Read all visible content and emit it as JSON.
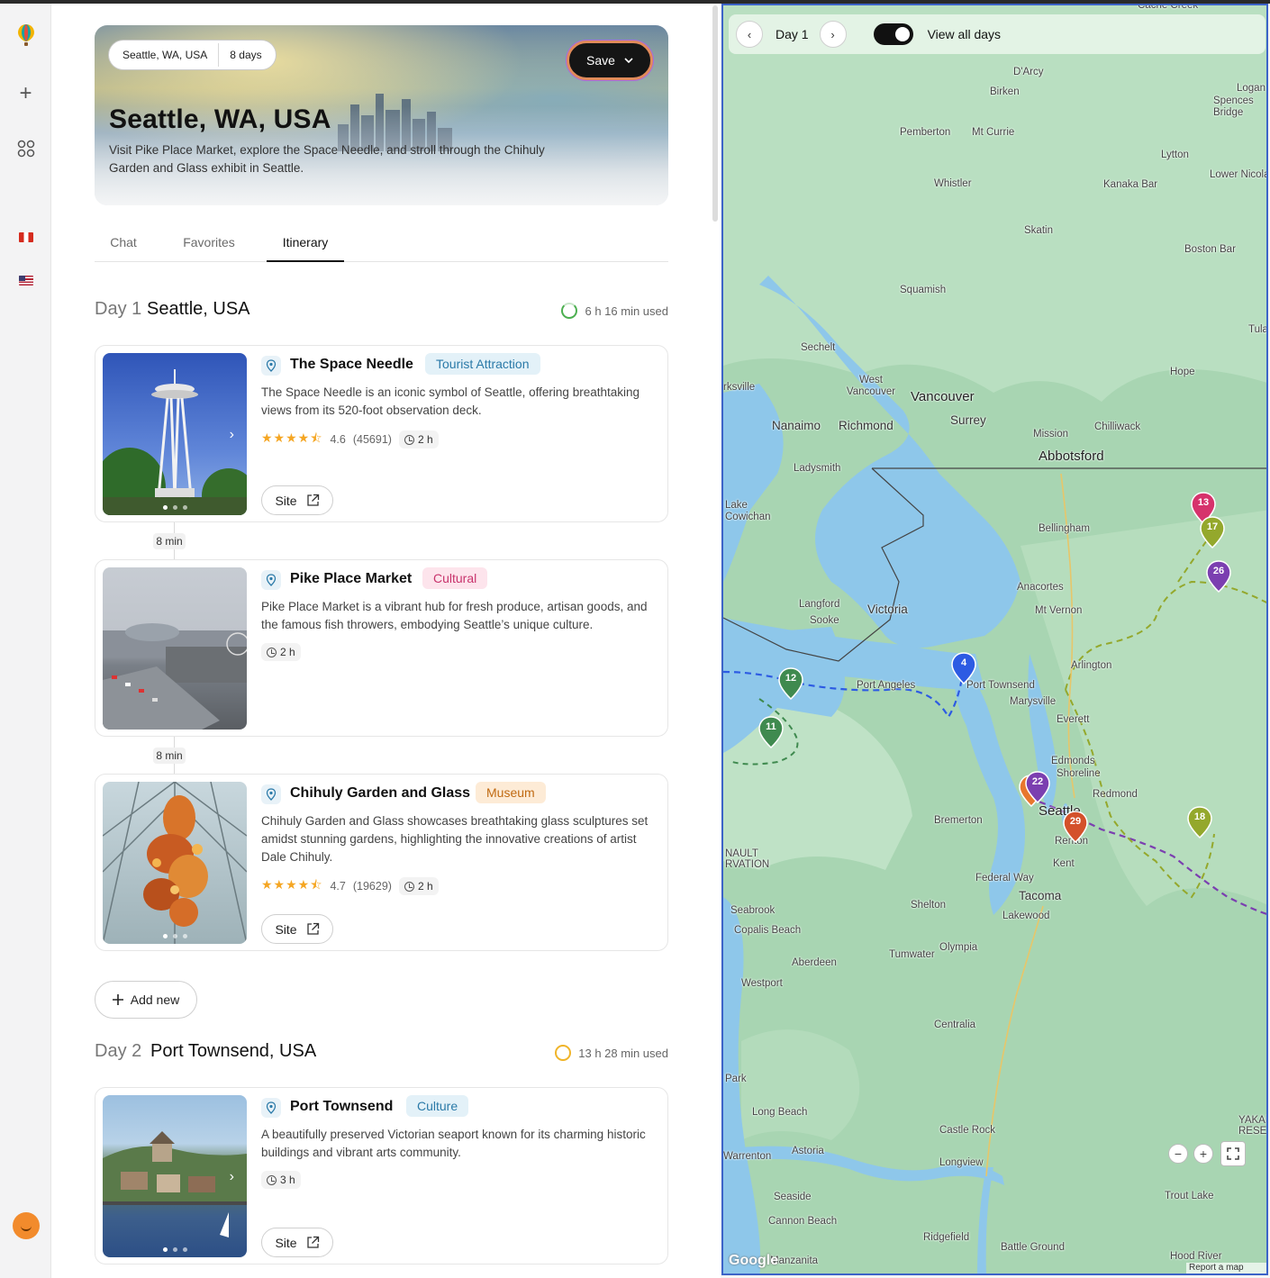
{
  "rail": {
    "items": [
      {
        "name": "balloon-logo-icon"
      },
      {
        "name": "plus-icon",
        "glyph": "+"
      },
      {
        "name": "apps-grid-icon"
      },
      {
        "name": "peru-flag-icon"
      },
      {
        "name": "usa-flag-icon"
      },
      {
        "name": "user-avatar"
      }
    ]
  },
  "hero": {
    "location_chip": "Seattle, WA, USA",
    "duration_chip": "8 days",
    "save_label": "Save",
    "title": "Seattle, WA, USA",
    "description": "Visit Pike Place Market, explore the Space Needle, and stroll through the Chihuly Garden and Glass exhibit in Seattle."
  },
  "tabs": [
    {
      "label": "Chat",
      "active": false
    },
    {
      "label": "Favorites",
      "active": false
    },
    {
      "label": "Itinerary",
      "active": true
    }
  ],
  "days": [
    {
      "label": "Day 1",
      "city": "Seattle, USA",
      "used": "6 h 16 min used",
      "ring_color": "#4caf50",
      "places": [
        {
          "title": "The Space Needle",
          "tag": "Tourist Attraction",
          "tag_color": "#2b7aa8",
          "tag_bg": "#e3f1f8",
          "description": "The Space Needle is an iconic symbol of Seattle, offering breathtaking views from its 520-foot observation deck.",
          "stars": "★★★★⯪",
          "rating": "4.6",
          "reviews": "(45691)",
          "duration": "2 h",
          "site_label": "Site"
        },
        {
          "title": "Pike Place Market",
          "tag": "Cultural",
          "tag_color": "#c8336c",
          "tag_bg": "#fde4ec",
          "description": "Pike Place Market is a vibrant hub for fresh produce, artisan goods, and the famous fish throwers, embodying Seattle’s unique culture.",
          "duration": "2 h"
        },
        {
          "title": "Chihuly Garden and Glass",
          "tag": "Museum",
          "tag_color": "#c06a12",
          "tag_bg": "#fdebd6",
          "description": "Chihuly Garden and Glass showcases breathtaking glass sculptures set amidst stunning gardens, highlighting the innovative creations of artist Dale Chihuly.",
          "stars": "★★★★⯪",
          "rating": "4.7",
          "reviews": "(19629)",
          "duration": "2 h",
          "site_label": "Site"
        }
      ],
      "travel_times": [
        "8 min",
        "8 min"
      ],
      "add_label": "Add new"
    },
    {
      "label": "Day 2",
      "city": "Port Townsend, USA",
      "used": "13 h 28 min used",
      "ring_color": "#f0b429",
      "places": [
        {
          "title": "Port Townsend",
          "tag": "Culture",
          "tag_color": "#2b7aa8",
          "tag_bg": "#e3f1f8",
          "description": "A beautifully preserved Victorian seaport known for its charming historic buildings and vibrant arts community.",
          "duration": "3 h",
          "site_label": "Site"
        }
      ]
    }
  ],
  "map": {
    "day_label": "Day 1",
    "prev_glyph": "‹",
    "next_glyph": "›",
    "toggle_label": "View all days",
    "toggle_on": true,
    "places": [
      "Cache Creek",
      "D'Arcy",
      "Birken",
      "Logan La",
      "Spences Bridge",
      "Pemberton",
      "Mt Currie",
      "Lytton",
      "Lower Nicola",
      "Whistler",
      "Kanaka Bar",
      "Skatin",
      "Boston Bar",
      "Squamish",
      "Tulan",
      "Sechelt",
      "Hope",
      "West Vancouver",
      "Vancouver",
      "rksville",
      "Nanaimo",
      "Richmond",
      "Surrey",
      "Mission",
      "Chilliwack",
      "Abbotsford",
      "Ladysmith",
      "Lake Cowichan",
      "Bellingham",
      "Langford",
      "Sooke",
      "Victoria",
      "Anacortes",
      "Mt Vernon",
      "Arlington",
      "Port Angeles",
      "Port Townsend",
      "Marysville",
      "Everett",
      "Edmonds",
      "Shoreline",
      "Redmond",
      "Bremerton",
      "Seattle",
      "Renton",
      "Kent",
      "NAULT RVATION",
      "Federal Way",
      "Tacoma",
      "Seabrook",
      "Shelton",
      "Copalis Beach",
      "Lakewood",
      "Tumwater",
      "Olympia",
      "Aberdeen",
      "Westport",
      "Centralia",
      "Long Beach",
      "Castle Rock",
      "Astoria",
      "Warrenton",
      "Longview",
      "Seaside",
      "Cannon Beach",
      "Ridgefield",
      "Battle Ground",
      "Trout Lake",
      "YAKAM RESE",
      "Manzanita",
      "Hood River",
      "Park"
    ],
    "markers": [
      {
        "num": "13",
        "color": "#d6336c"
      },
      {
        "num": "17",
        "color": "#94a82c"
      },
      {
        "num": "26",
        "color": "#7b3fb0"
      },
      {
        "num": "4",
        "color": "#2d5be3"
      },
      {
        "num": "12",
        "color": "#3f8a4f"
      },
      {
        "num": "11",
        "color": "#3f8a4f"
      },
      {
        "num": "22",
        "color": "#7b3fb0"
      },
      {
        "num": "29",
        "color": "#d4512b"
      },
      {
        "num": "18",
        "color": "#94a82c"
      }
    ],
    "zoom_out_glyph": "−",
    "zoom_in_glyph": "+",
    "google_label": "Google",
    "report_label": "Report a map error"
  }
}
